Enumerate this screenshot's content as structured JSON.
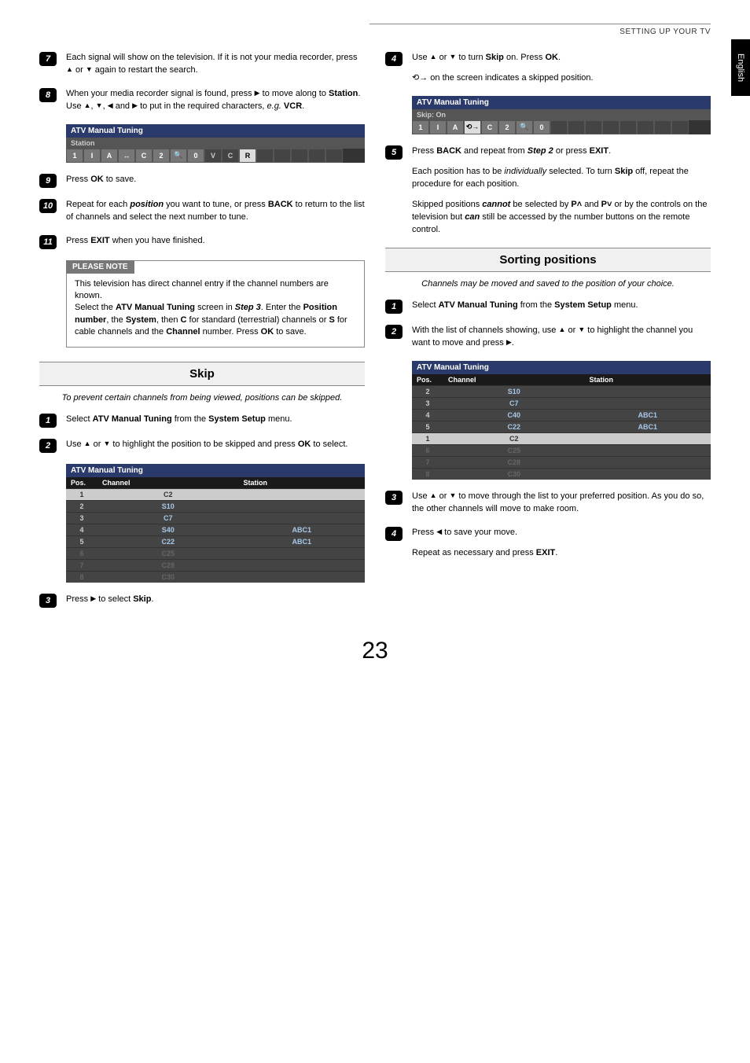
{
  "header": "SETTING UP YOUR TV",
  "lang_tab": "English",
  "page_number": "23",
  "icons": {
    "up": "▲",
    "down": "▼",
    "left": "◀",
    "right": "▶",
    "pup": "P˄",
    "pdown": "P˅",
    "skipmark": "⟲→"
  },
  "left": {
    "s7": {
      "num": "7",
      "text_a": "Each signal will show on the television. If it is not your media recorder, press ",
      "text_b": " or ",
      "text_c": " again to restart the search."
    },
    "s8": {
      "num": "8",
      "text_a": "When your media recorder signal is found, press ",
      "text_b": " to move along to ",
      "station": "Station",
      "text_c": ". Use ",
      "text_d": ", ",
      "text_e": ", ",
      "text_f": " and ",
      "text_g": " to put in the required characters, ",
      "eg": "e.g.",
      "vcr": " VCR",
      "period": "."
    },
    "osd1": {
      "title": "ATV Manual Tuning",
      "sub": "Station",
      "cells": [
        "1",
        "I",
        "A",
        "↔",
        "C",
        "2",
        "🔍",
        "0",
        "V",
        "C",
        "R",
        "",
        "",
        "",
        "",
        ""
      ]
    },
    "s9": {
      "num": "9",
      "text_a": "Press ",
      "ok": "OK",
      "text_b": " to save."
    },
    "s10": {
      "num": "10",
      "text_a": "Repeat for each ",
      "pos": "position",
      "text_b": " you want to tune, or press ",
      "back": "BACK",
      "text_c": " to return to the list of channels and select the next number to tune."
    },
    "s11": {
      "num": "11",
      "text_a": "Press ",
      "exit": "EXIT",
      "text_b": " when you have finished."
    },
    "note": {
      "title": "PLEASE NOTE",
      "l1": "This television has direct channel entry if the channel numbers are known.",
      "l2a": "Select the ",
      "l2b": "ATV Manual Tuning",
      "l2c": " screen in ",
      "l2d": "Step 3",
      "l2e": ". Enter the ",
      "l2f": "Position number",
      "l2g": ", the ",
      "l2h": "System",
      "l2i": ", then ",
      "l2j": "C",
      "l2k": " for standard (terrestrial) channels or ",
      "l2l": "S",
      "l2m": " for cable channels and the ",
      "l2n": "Channel",
      "l2o": " number. Press ",
      "l2p": "OK",
      "l2q": " to save."
    },
    "skip_title": "Skip",
    "skip_intro": "To prevent certain channels from being viewed, positions can be skipped.",
    "sk1": {
      "num": "1",
      "text_a": "Select ",
      "b": "ATV Manual Tuning",
      "text_b": " from the ",
      "c": "System Setup",
      "text_c": " menu."
    },
    "sk2": {
      "num": "2",
      "text_a": "Use ",
      "text_b": " or ",
      "text_c": " to highlight the position to be skipped and press ",
      "ok": "OK",
      "text_d": " to select."
    },
    "osd2": {
      "title": "ATV Manual Tuning",
      "headers": [
        "Pos.",
        "Channel",
        "Station"
      ],
      "rows": [
        {
          "pos": "1",
          "ch": "C2",
          "st": "",
          "sel": true
        },
        {
          "pos": "2",
          "ch": "S10",
          "st": ""
        },
        {
          "pos": "3",
          "ch": "C7",
          "st": ""
        },
        {
          "pos": "4",
          "ch": "S40",
          "st": "ABC1"
        },
        {
          "pos": "5",
          "ch": "C22",
          "st": "ABC1"
        },
        {
          "pos": "6",
          "ch": "C25",
          "st": "",
          "dim": true
        },
        {
          "pos": "7",
          "ch": "C28",
          "st": "",
          "dim": true
        },
        {
          "pos": "8",
          "ch": "C30",
          "st": "",
          "dim": true
        }
      ]
    },
    "sk3": {
      "num": "3",
      "text_a": "Press ",
      "text_b": " to select ",
      "skip": "Skip",
      "period": "."
    }
  },
  "right": {
    "s4": {
      "num": "4",
      "text_a": "Use ",
      "text_b": " or ",
      "text_c": " to turn ",
      "skip": "Skip",
      "text_d": " on. Press ",
      "ok": "OK",
      "period": ".",
      "foot": " on the screen indicates a skipped position."
    },
    "osd1": {
      "title": "ATV Manual Tuning",
      "sub": "Skip: On",
      "cells": [
        "1",
        "I",
        "A",
        "⟲→",
        "C",
        "2",
        "🔍",
        "0",
        "",
        "",
        "",
        "",
        "",
        "",
        "",
        ""
      ]
    },
    "s5": {
      "num": "5",
      "text_a": "Press ",
      "back": "BACK",
      "text_b": " and repeat from ",
      "step2": "Step 2",
      "text_c": " or press ",
      "exit": "EXIT",
      "period": ".",
      "p2a": "Each position has to be ",
      "p2b": "individually",
      "p2c": " selected. To turn ",
      "p2d": "Skip",
      "p2e": " off, repeat the procedure for each position.",
      "p3a": "Skipped positions ",
      "p3b": "cannot",
      "p3c": " be selected by ",
      "p3d": " and ",
      "p3e": " or by the controls on the television but ",
      "p3f": "can",
      "p3g": " still be accessed by the number buttons on the remote control."
    },
    "sort_title": "Sorting positions",
    "sort_intro": "Channels may be moved and saved to the position of your choice.",
    "so1": {
      "num": "1",
      "text_a": "Select ",
      "b": "ATV Manual Tuning",
      "text_b": " from the ",
      "c": "System Setup",
      "text_c": " menu."
    },
    "so2": {
      "num": "2",
      "text_a": "With the list of channels showing, use ",
      "text_b": " or ",
      "text_c": " to highlight the channel you want to move and press ",
      "period": "."
    },
    "osd2": {
      "title": "ATV Manual Tuning",
      "headers": [
        "Pos.",
        "Channel",
        "Station"
      ],
      "rows": [
        {
          "pos": "2",
          "ch": "S10",
          "st": ""
        },
        {
          "pos": "3",
          "ch": "C7",
          "st": ""
        },
        {
          "pos": "4",
          "ch": "C40",
          "st": "ABC1"
        },
        {
          "pos": "5",
          "ch": "C22",
          "st": "ABC1"
        },
        {
          "pos": "1",
          "ch": "C2",
          "st": "",
          "sel": true
        },
        {
          "pos": "6",
          "ch": "C25",
          "st": "",
          "dim": true
        },
        {
          "pos": "7",
          "ch": "C28",
          "st": "",
          "dim": true
        },
        {
          "pos": "8",
          "ch": "C30",
          "st": "",
          "dim": true
        }
      ]
    },
    "so3": {
      "num": "3",
      "text_a": "Use ",
      "text_b": " or ",
      "text_c": " to move through the list to your preferred position. As you do so, the other channels will move to make room."
    },
    "so4": {
      "num": "4",
      "text_a": "Press ",
      "text_b": " to save your move.",
      "p2a": "Repeat as necessary and press ",
      "exit": "EXIT",
      "period": "."
    }
  }
}
